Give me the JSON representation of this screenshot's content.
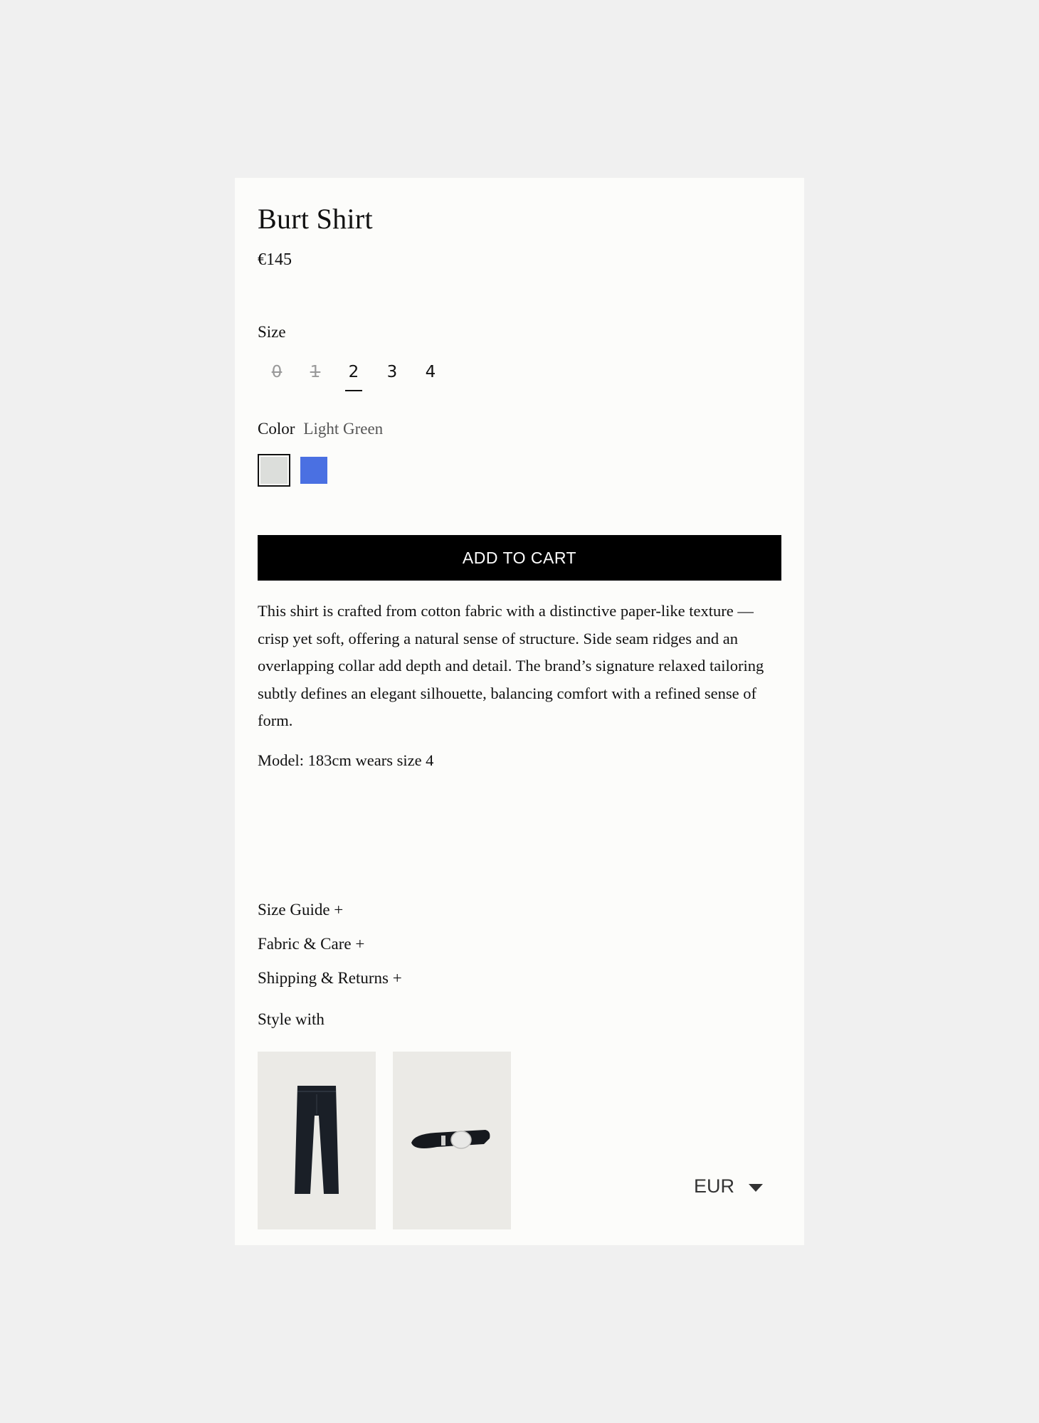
{
  "product": {
    "title": "Burt Shirt",
    "price": "€145"
  },
  "size": {
    "label": "Size",
    "options": [
      {
        "label": "0",
        "state": "unavailable"
      },
      {
        "label": "1",
        "state": "unavailable"
      },
      {
        "label": "2",
        "state": "selected"
      },
      {
        "label": "3",
        "state": "available"
      },
      {
        "label": "4",
        "state": "available"
      }
    ]
  },
  "color": {
    "label": "Color",
    "selected_name": "Light Green",
    "swatches": [
      {
        "color": "#dcdedb",
        "selected": true
      },
      {
        "color": "#4a70e2",
        "selected": false
      }
    ]
  },
  "add_to_cart_label": "ADD TO CART",
  "description": "This shirt is crafted from cotton fabric with a distinctive paper-like texture — crisp yet soft, offering a natural sense of structure. Side seam ridges and an overlapping collar add depth and detail. The brand’s signature relaxed tailoring subtly defines an elegant silhouette, balancing comfort with a refined sense of form.",
  "model_info": "Model: 183cm wears size 4",
  "accordions": [
    {
      "label": "Size Guide +"
    },
    {
      "label": "Fabric & Care +"
    },
    {
      "label": "Shipping & Returns +"
    }
  ],
  "style_with": {
    "label": "Style with",
    "items": [
      {
        "icon": "trousers-image"
      },
      {
        "icon": "belt-image"
      }
    ]
  },
  "currency": {
    "value": "EUR",
    "icon": "caret-down-icon"
  }
}
